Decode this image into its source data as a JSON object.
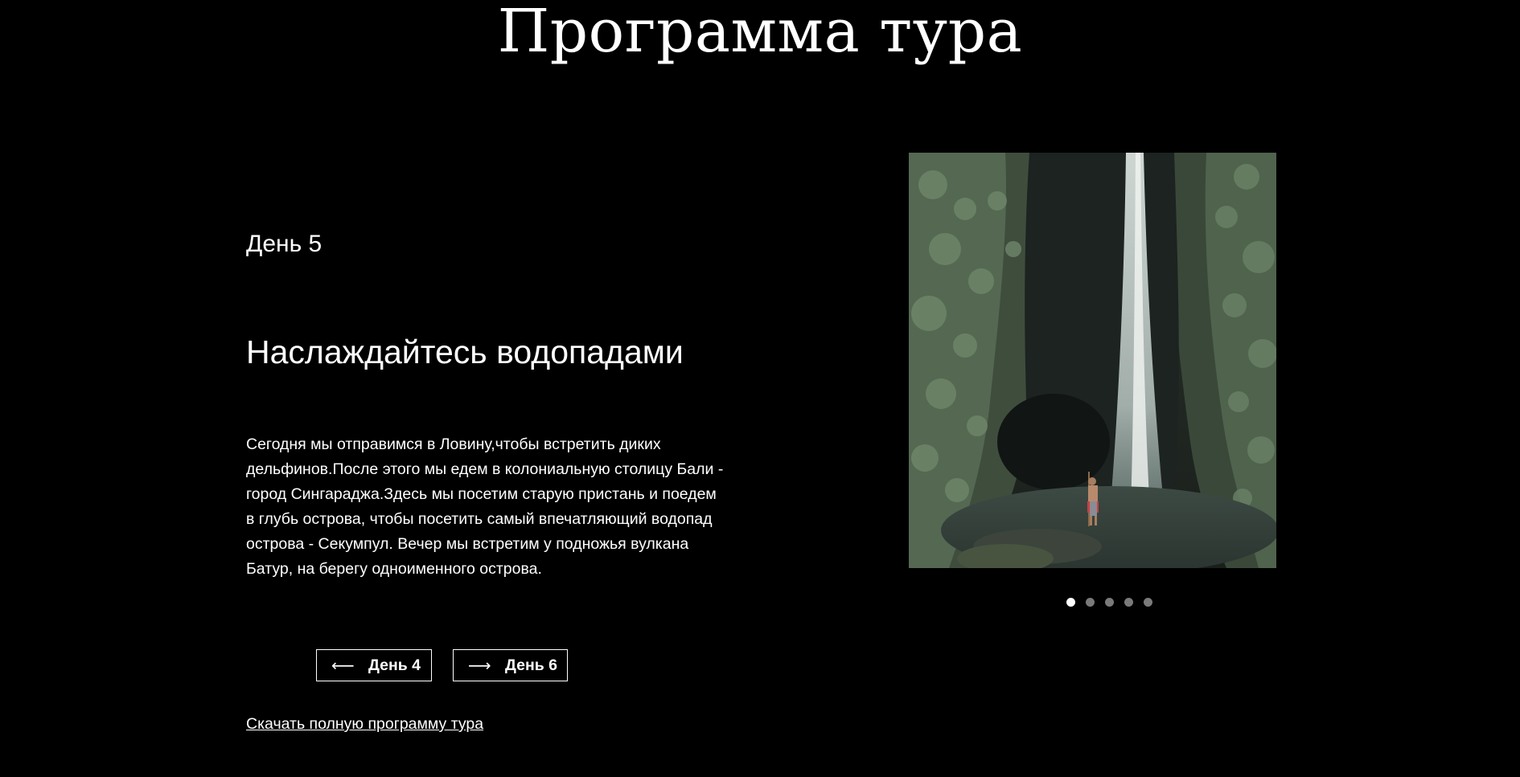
{
  "page": {
    "title": "Программа тура"
  },
  "day": {
    "label": "День 5",
    "heading": "Наслаждайтесь водопадами",
    "description": "Сегодня мы отправимся в Ловину,чтобы встретить диких дельфинов.После этого мы едем в колониальную столицу Бали - город Сингараджа.Здесь мы посетим старую пристань и поедем в глубь острова, чтобы посетить самый впечатляющий водопад острова - Секумпул. Вечер мы встретим у подножья вулкана Батур, на берегу одноименного острова."
  },
  "navigation": {
    "prev": {
      "label": "День 4",
      "icon": "arrow-left-icon"
    },
    "next": {
      "label": "День 6",
      "icon": "arrow-right-icon"
    }
  },
  "download": {
    "label": "Скачать полную программу тура"
  },
  "slider": {
    "image": "waterfall-photo",
    "slide_count": 5,
    "active_index": 0
  },
  "colors": {
    "background": "#000000",
    "text": "#ffffff",
    "dot_inactive": "#7a7a7a",
    "dot_active": "#ffffff"
  }
}
